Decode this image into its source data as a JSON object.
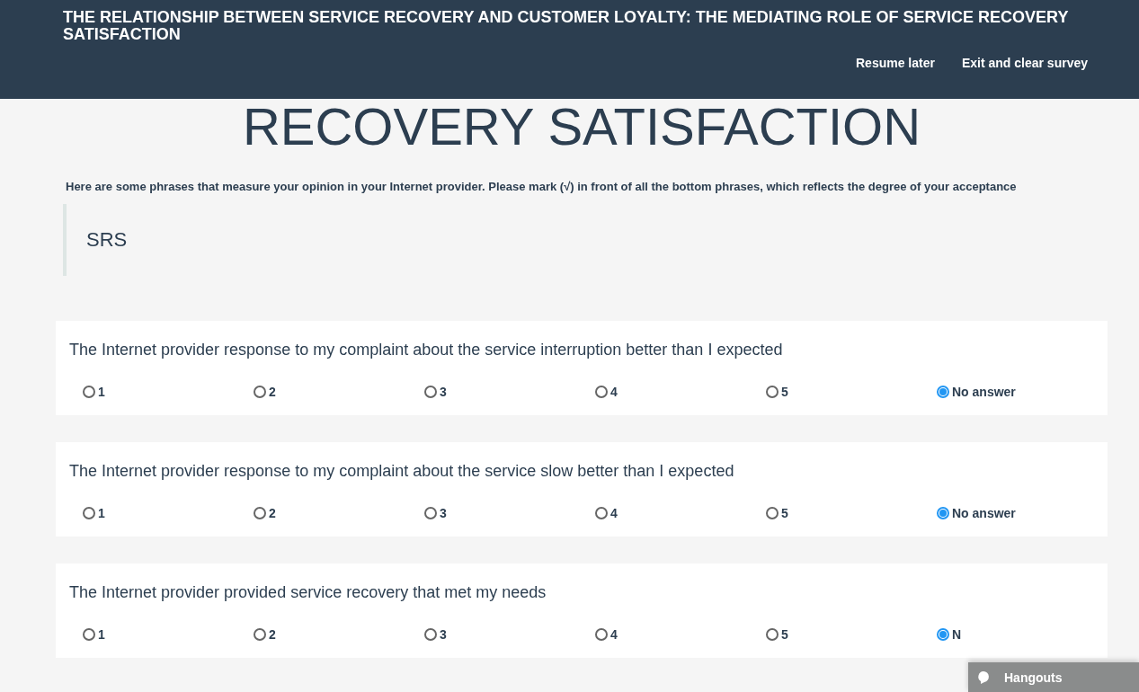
{
  "header": {
    "title": "THE RELATIONSHIP BETWEEN SERVICE RECOVERY AND CUSTOMER LOYALTY: THE MEDIATING ROLE OF SERVICE RECOVERY SATISFACTION",
    "links": [
      "Resume later",
      "Exit and clear survey"
    ]
  },
  "group_title": "RECOVERY SATISFACTION",
  "description": "Here are some phrases that measure your opinion in your Internet provider. Please mark (√) in front of all the bottom phrases, which reflects the degree of your acceptance",
  "section": "SRS",
  "questions": [
    {
      "text": "The Internet provider response to my complaint about the service interruption better than I expected",
      "options": [
        {
          "label": "1",
          "selected": false
        },
        {
          "label": "2",
          "selected": false
        },
        {
          "label": "3",
          "selected": false
        },
        {
          "label": "4",
          "selected": false
        },
        {
          "label": "5",
          "selected": false
        },
        {
          "label": "No answer",
          "selected": true
        }
      ]
    },
    {
      "text": "The Internet provider response to my complaint about the service slow better than I expected",
      "options": [
        {
          "label": "1",
          "selected": false
        },
        {
          "label": "2",
          "selected": false
        },
        {
          "label": "3",
          "selected": false
        },
        {
          "label": "4",
          "selected": false
        },
        {
          "label": "5",
          "selected": false
        },
        {
          "label": "No answer",
          "selected": true
        }
      ]
    },
    {
      "text": "The Internet provider provided service recovery that met my needs",
      "options": [
        {
          "label": "1",
          "selected": false
        },
        {
          "label": "2",
          "selected": false
        },
        {
          "label": "3",
          "selected": false
        },
        {
          "label": "4",
          "selected": false
        },
        {
          "label": "5",
          "selected": false
        },
        {
          "label": "N",
          "selected": true
        }
      ]
    }
  ],
  "chat_widget": {
    "label": "Hangouts"
  }
}
